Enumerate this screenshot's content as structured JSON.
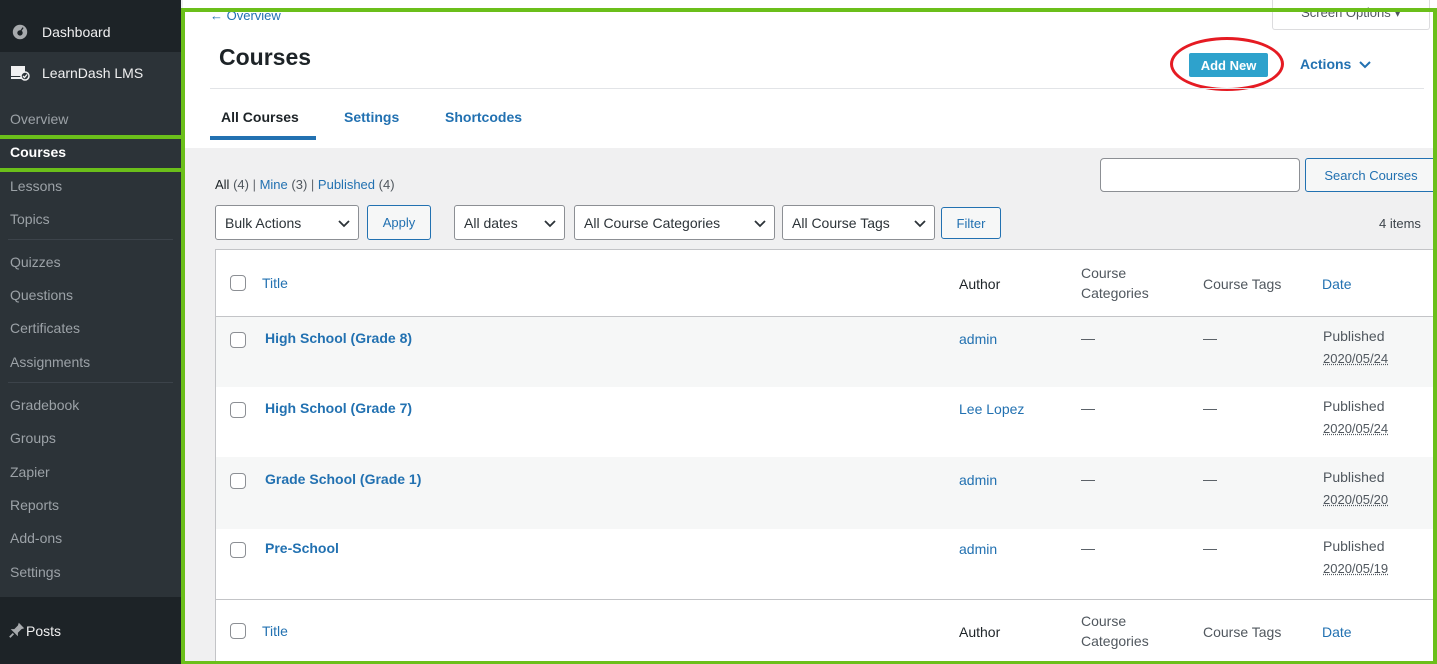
{
  "sidebar": {
    "dashboard": "Dashboard",
    "learndash": "LearnDash LMS",
    "submenu": [
      "Overview",
      "Courses",
      "Lessons",
      "Topics",
      "Quizzes",
      "Questions",
      "Certificates",
      "Assignments",
      "Gradebook",
      "Groups",
      "Zapier",
      "Reports",
      "Add-ons",
      "Settings"
    ],
    "posts": "Posts"
  },
  "header": {
    "back_link": "← Overview",
    "screen_options": "Screen Options ▾",
    "title": "Courses",
    "add_new": "Add New",
    "actions": "Actions"
  },
  "tabs": [
    "All Courses",
    "Settings",
    "Shortcodes"
  ],
  "filters": {
    "views": {
      "all": "All",
      "all_count": "(4)",
      "mine": "Mine",
      "mine_count": "(3)",
      "published": "Published",
      "published_count": "(4)"
    },
    "search_button": "Search Courses",
    "bulk_actions": "Bulk Actions",
    "apply": "Apply",
    "all_dates": "All dates",
    "all_categories": "All Course Categories",
    "all_tags": "All Course Tags",
    "filter": "Filter",
    "items": "4 items"
  },
  "table": {
    "columns": {
      "title": "Title",
      "author": "Author",
      "categories_1": "Course",
      "categories_2": "Categories",
      "tags": "Course Tags",
      "date": "Date"
    },
    "rows": [
      {
        "title": "High School (Grade 8)",
        "author": "admin",
        "categories": "—",
        "tags": "—",
        "status": "Published",
        "date": "2020/05/24"
      },
      {
        "title": "High School (Grade 7)",
        "author": "Lee Lopez",
        "categories": "—",
        "tags": "—",
        "status": "Published",
        "date": "2020/05/24"
      },
      {
        "title": "Grade School (Grade 1)",
        "author": "admin",
        "categories": "—",
        "tags": "—",
        "status": "Published",
        "date": "2020/05/20"
      },
      {
        "title": "Pre-School",
        "author": "admin",
        "categories": "—",
        "tags": "—",
        "status": "Published",
        "date": "2020/05/19"
      }
    ]
  },
  "colors": {
    "accent": "#2271b1",
    "highlight_green": "#6bbf1a",
    "annotation_red": "#e51b23",
    "add_new_bg": "#2ea2cc"
  }
}
